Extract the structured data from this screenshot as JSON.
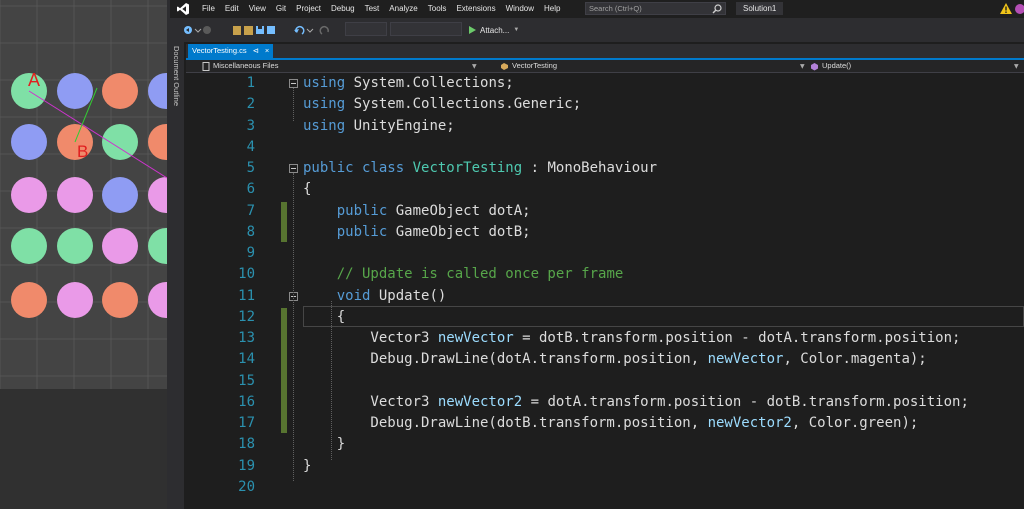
{
  "scene": {
    "labels": {
      "a": "A",
      "b": "B"
    },
    "colors": {
      "background": "#444444",
      "green": "#7fe0a6",
      "blue": "#8f9cf3",
      "orange": "#f08a6b",
      "pink": "#ea9ae8",
      "magenta_line": "#cc33cc",
      "green_line": "#33cc33",
      "label_red": "#e02020"
    },
    "dots": [
      [
        "green",
        "blue",
        "orange",
        "blue"
      ],
      [
        "blue",
        "orange",
        "green",
        "orange"
      ],
      [
        "pink",
        "pink",
        "blue",
        "pink"
      ],
      [
        "green",
        "green",
        "pink",
        "green"
      ],
      [
        "orange",
        "pink",
        "orange",
        "pink"
      ]
    ]
  },
  "menubar": {
    "items": [
      "File",
      "Edit",
      "View",
      "Git",
      "Project",
      "Debug",
      "Test",
      "Analyze",
      "Tools",
      "Extensions",
      "Window",
      "Help"
    ],
    "search_placeholder": "Search (Ctrl+Q)",
    "solution": "Solution1"
  },
  "toolbar": {
    "attach_label": "Attach..."
  },
  "side_panel": {
    "label": "Document Outline"
  },
  "tab": {
    "title": "VectorTesting.cs",
    "pin": "⊲",
    "close": "×"
  },
  "navbar": {
    "project": "Miscellaneous Files",
    "class": "VectorTesting",
    "member": "Update()"
  },
  "editor": {
    "colors": {
      "keyword": "#569cd6",
      "type": "#4ec9b0",
      "comment": "#57a64a",
      "variable": "#9cdcfe",
      "text": "#dcdcdc",
      "line_number": "#2b91af"
    },
    "lines": [
      {
        "n": "1",
        "tokens": [
          [
            "kw",
            "using"
          ],
          [
            "",
            " System.Collections;"
          ]
        ]
      },
      {
        "n": "2",
        "tokens": [
          [
            "kw",
            "using"
          ],
          [
            "",
            " System.Collections.Generic;"
          ]
        ]
      },
      {
        "n": "3",
        "tokens": [
          [
            "kw",
            "using"
          ],
          [
            "",
            " UnityEngine;"
          ]
        ]
      },
      {
        "n": "4",
        "tokens": []
      },
      {
        "n": "5",
        "tokens": [
          [
            "kw",
            "public class"
          ],
          [
            "",
            " "
          ],
          [
            "ty",
            "VectorTesting"
          ],
          [
            "",
            " : MonoBehaviour"
          ]
        ]
      },
      {
        "n": "6",
        "tokens": [
          [
            "",
            "{"
          ]
        ]
      },
      {
        "n": "7",
        "tokens": [
          [
            "",
            "    "
          ],
          [
            "kw",
            "public"
          ],
          [
            "",
            " GameObject dotA;"
          ]
        ]
      },
      {
        "n": "8",
        "tokens": [
          [
            "",
            "    "
          ],
          [
            "kw",
            "public"
          ],
          [
            "",
            " GameObject dotB;"
          ]
        ]
      },
      {
        "n": "9",
        "tokens": []
      },
      {
        "n": "10",
        "tokens": [
          [
            "",
            "    "
          ],
          [
            "cm",
            "// Update is called once per frame"
          ]
        ]
      },
      {
        "n": "11",
        "tokens": [
          [
            "",
            "    "
          ],
          [
            "kw",
            "void"
          ],
          [
            "",
            " Update()"
          ]
        ]
      },
      {
        "n": "12",
        "tokens": [
          [
            "",
            "    {"
          ]
        ]
      },
      {
        "n": "13",
        "tokens": [
          [
            "",
            "        Vector3 "
          ],
          [
            "var",
            "newVector"
          ],
          [
            "",
            " = dotB.transform.position - dotA.transform.position;"
          ]
        ]
      },
      {
        "n": "14",
        "tokens": [
          [
            "",
            "        Debug.DrawLine(dotA.transform.position, "
          ],
          [
            "var",
            "newVector"
          ],
          [
            "",
            ", Color.magenta);"
          ]
        ]
      },
      {
        "n": "15",
        "tokens": []
      },
      {
        "n": "16",
        "tokens": [
          [
            "",
            "        Vector3 "
          ],
          [
            "var",
            "newVector2"
          ],
          [
            "",
            " = dotA.transform.position - dotB.transform.position;"
          ]
        ]
      },
      {
        "n": "17",
        "tokens": [
          [
            "",
            "        Debug.DrawLine(dotB.transform.position, "
          ],
          [
            "var",
            "newVector2"
          ],
          [
            "",
            ", Color.green);"
          ]
        ]
      },
      {
        "n": "18",
        "tokens": [
          [
            "",
            "    }"
          ]
        ]
      },
      {
        "n": "19",
        "tokens": [
          [
            "",
            "}"
          ]
        ]
      },
      {
        "n": "20",
        "tokens": []
      }
    ]
  }
}
